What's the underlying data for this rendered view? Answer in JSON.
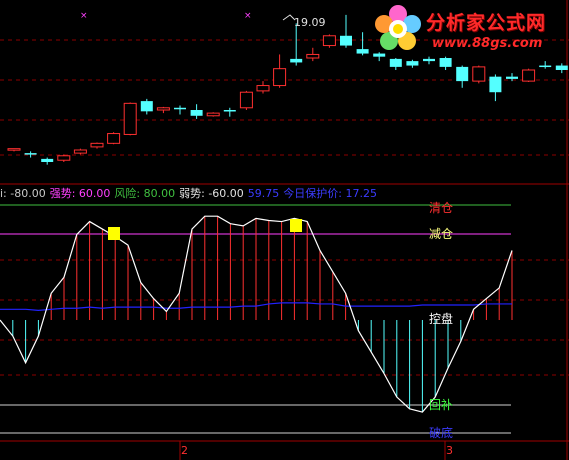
{
  "logo": {
    "title": "分析家公式网",
    "url": "www.88gs.com"
  },
  "price_panel": {
    "high_label": "19.09"
  },
  "indicator_bar": {
    "items": [
      {
        "text": "i: -80.00",
        "color": "#c8c8c8"
      },
      {
        "text": "强势: 60.00",
        "color": "#ff40ff"
      },
      {
        "text": "风险: 80.00",
        "color": "#40c040"
      },
      {
        "text": "弱势: -60.00",
        "color": "#e0e0e0"
      },
      {
        "text": "59.75",
        "color": "#3c3cff"
      },
      {
        "text": "今日保护价: 17.25",
        "color": "#3c3cff"
      }
    ]
  },
  "zones": {
    "top": "清仓",
    "reduce": "减仓",
    "control": "控盘",
    "add": "回补",
    "bottom": "破底"
  },
  "axis": {
    "ticks": [
      "2",
      "3"
    ]
  },
  "colors": {
    "up": "#ff3030",
    "down": "#54ffff",
    "line": "#ffffff",
    "blue": "#2222ff"
  },
  "chart_data": [
    {
      "type": "candlestick",
      "series": [
        {
          "values_ohlc": [
            [
              16.05,
              16.08,
              16.02,
              16.05
            ],
            [
              15.98,
              15.95,
              15.88,
              16.02
            ],
            [
              15.85,
              15.78,
              15.72,
              15.88
            ],
            [
              15.82,
              15.92,
              15.78,
              15.95
            ],
            [
              15.98,
              16.05,
              15.95,
              16.08
            ],
            [
              16.12,
              16.2,
              16.08,
              16.22
            ],
            [
              16.2,
              16.42,
              16.18,
              16.45
            ],
            [
              16.4,
              17.1,
              16.38,
              17.12
            ],
            [
              17.15,
              16.92,
              16.85,
              17.2
            ],
            [
              16.95,
              17.0,
              16.88,
              17.02
            ],
            [
              17.0,
              16.98,
              16.85,
              17.05
            ],
            [
              16.95,
              16.82,
              16.75,
              17.08
            ],
            [
              16.82,
              16.88,
              16.8,
              16.9
            ],
            [
              16.95,
              16.92,
              16.8,
              17.0
            ],
            [
              17.0,
              17.35,
              16.95,
              17.38
            ],
            [
              17.38,
              17.5,
              17.32,
              17.6
            ],
            [
              17.5,
              17.88,
              17.45,
              18.2
            ],
            [
              18.1,
              18.02,
              17.95,
              18.9
            ],
            [
              18.12,
              18.2,
              18.05,
              18.35
            ],
            [
              18.4,
              18.62,
              18.35,
              18.65
            ],
            [
              18.62,
              18.4,
              18.35,
              19.09
            ],
            [
              18.32,
              18.22,
              18.18,
              18.7
            ],
            [
              18.22,
              18.15,
              18.05,
              18.25
            ],
            [
              18.1,
              17.92,
              17.85,
              18.12
            ],
            [
              18.05,
              17.95,
              17.9,
              18.08
            ],
            [
              18.1,
              18.05,
              17.98,
              18.15
            ],
            [
              18.12,
              17.92,
              17.85,
              18.15
            ],
            [
              17.92,
              17.6,
              17.45,
              17.95
            ],
            [
              17.6,
              17.92,
              17.55,
              17.95
            ],
            [
              17.7,
              17.35,
              17.15,
              17.75
            ],
            [
              17.7,
              17.65,
              17.6,
              17.78
            ],
            [
              17.6,
              17.85,
              17.58,
              17.88
            ],
            [
              17.95,
              17.92,
              17.88,
              18.05
            ],
            [
              17.95,
              17.85,
              17.78,
              18.0
            ],
            [
              17.98,
              17.95,
              17.85,
              18.25
            ]
          ]
        }
      ]
    },
    {
      "type": "line",
      "ylim": [
        -100,
        100
      ],
      "reference_lines": [
        100,
        80,
        60,
        -60,
        -80,
        -100
      ],
      "series": [
        {
          "values": [
            0,
            -15,
            -40,
            -15,
            25,
            40,
            80,
            92,
            85,
            78,
            70,
            35,
            20,
            8,
            25,
            85,
            97,
            97,
            90,
            88,
            95,
            93,
            92,
            95,
            92,
            65,
            45,
            25,
            -10,
            -30,
            -50,
            -72,
            -83,
            -86,
            -72,
            -45,
            -20,
            10,
            20,
            30,
            65
          ]
        },
        {
          "values": [
            10,
            10,
            10,
            9,
            10,
            11,
            11,
            12,
            11,
            12,
            12,
            12,
            12,
            11,
            11,
            12,
            12,
            12,
            12,
            13,
            13,
            15,
            16,
            16,
            16,
            15,
            15,
            13,
            13,
            13,
            13,
            13,
            13,
            14,
            14,
            14,
            14,
            14,
            15,
            15,
            15
          ]
        }
      ]
    }
  ]
}
